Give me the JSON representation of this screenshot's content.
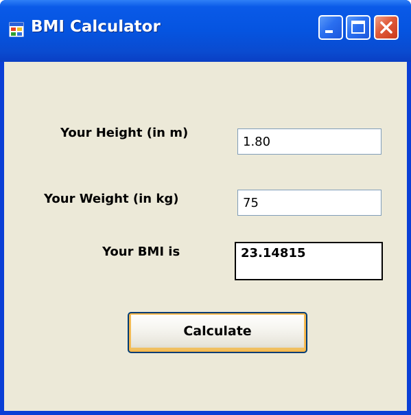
{
  "window": {
    "title": "BMI Calculator",
    "icon": "app-window-icon",
    "controls": {
      "minimize": "minimize-icon",
      "maximize": "maximize-icon",
      "close": "close-icon"
    },
    "colors": {
      "titlebar": "#0554e0",
      "client_background": "#ece9d8",
      "close_button": "#e05a38",
      "button_focus": "#f8b64a"
    }
  },
  "form": {
    "height_label": "Your Height (in m)",
    "height_value": "1.80",
    "weight_label": "Your Weight (in kg)",
    "weight_value": "75",
    "bmi_label": "Your BMI is",
    "bmi_value": "23.14815",
    "calculate_label": "Calculate"
  }
}
